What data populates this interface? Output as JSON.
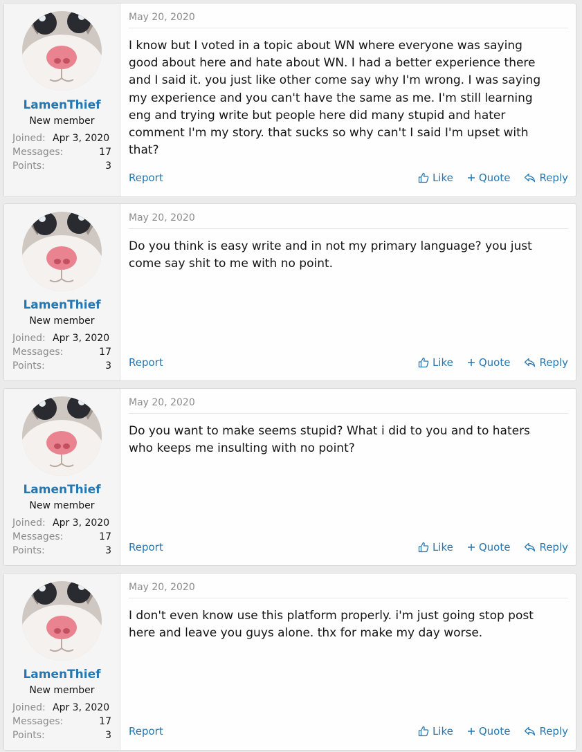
{
  "posts": [
    {
      "author": "LamenThief",
      "user_title": "New member",
      "joined_label": "Joined:",
      "joined": "Apr 3, 2020",
      "messages_label": "Messages:",
      "messages": "17",
      "points_label": "Points:",
      "points": "3",
      "date": "May 20, 2020",
      "lines": [
        "I know but I voted in a topic about WN where everyone was saying",
        "good about here and hate about WN. I had a better experience there",
        "and I said it. you just like other come say why I'm wrong. I was saying",
        "my experience and you can't have the same as me. I'm still learning",
        "eng and trying write but people here did many stupid and hater",
        "comment I'm my story. that sucks so why can't I said I'm upset with",
        "that?"
      ],
      "report": "Report",
      "like": "Like",
      "quote": "Quote",
      "reply": "Reply"
    },
    {
      "author": "LamenThief",
      "user_title": "New member",
      "joined_label": "Joined:",
      "joined": "Apr 3, 2020",
      "messages_label": "Messages:",
      "messages": "17",
      "points_label": "Points:",
      "points": "3",
      "date": "May 20, 2020",
      "lines": [
        "Do you think is easy write and in not my primary language? you just",
        "come say shit to me with no point."
      ],
      "report": "Report",
      "like": "Like",
      "quote": "Quote",
      "reply": "Reply"
    },
    {
      "author": "LamenThief",
      "user_title": "New member",
      "joined_label": "Joined:",
      "joined": "Apr 3, 2020",
      "messages_label": "Messages:",
      "messages": "17",
      "points_label": "Points:",
      "points": "3",
      "date": "May 20, 2020",
      "lines": [
        "Do you want to make seems stupid? What i did to you and to haters",
        "who keeps me insulting with no point?"
      ],
      "report": "Report",
      "like": "Like",
      "quote": "Quote",
      "reply": "Reply"
    },
    {
      "author": "LamenThief",
      "user_title": "New member",
      "joined_label": "Joined:",
      "joined": "Apr 3, 2020",
      "messages_label": "Messages:",
      "messages": "17",
      "points_label": "Points:",
      "points": "3",
      "date": "May 20, 2020",
      "lines": [
        "I don't even know use this platform properly. i'm just going stop post",
        "here and leave you guys alone. thx for make my day worse."
      ],
      "report": "Report",
      "like": "Like",
      "quote": "Quote",
      "reply": "Reply"
    }
  ],
  "icons": {
    "like": "thumbs-up-icon",
    "quote": "plus-icon",
    "reply": "reply-arrow-icon"
  },
  "colors": {
    "link": "#2577b1",
    "muted": "#8c8c8c",
    "page_bg": "#ebebeb",
    "user_cell_bg": "#f5f5f5"
  }
}
